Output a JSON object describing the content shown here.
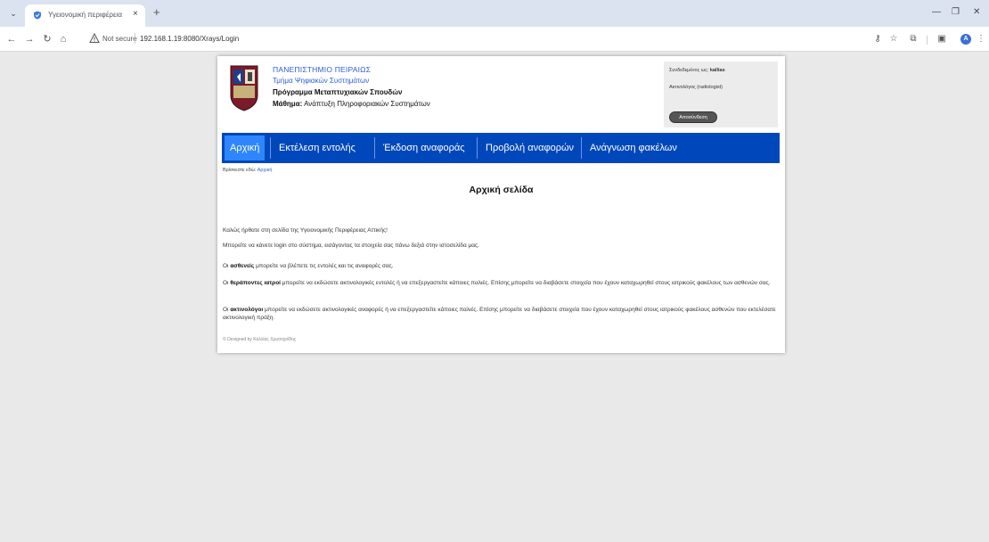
{
  "browser": {
    "tab_title": "Υγειονομική περιφέρεια",
    "not_secure": "Not secure",
    "url": "192.168.1.19:8080/Xrays/Login",
    "avatar_letter": "A"
  },
  "header": {
    "university": "ΠΑΝΕΠΙΣΤΗΜΙΟ ΠΕΙΡΑΙΩΣ",
    "department": "Τμήμα Ψηφιακών Συστημάτων",
    "program": "Πρόγραμμα Μεταπτυχιακών Σπουδών",
    "course_label": "Μάθημα:",
    "course_name": "Ανάπτυξη Πληροφοριακών Συστημάτων"
  },
  "user": {
    "logged_in_label": "Συνδεδεμένος ως:",
    "username": "kallias",
    "role": "Ακτινολόγος (radiologist)",
    "logout_label": "Αποσύνδεση"
  },
  "menu": [
    {
      "label": "Αρχική"
    },
    {
      "label": "Εκτέλεση εντολής"
    },
    {
      "label": "Έκδοση αναφοράς"
    },
    {
      "label": "Προβολή αναφορών"
    },
    {
      "label": "Ανάγνωση φακέλων"
    }
  ],
  "breadcrumb": {
    "prefix": "Βρίσκεστε εδώ:",
    "current": "Αρχική"
  },
  "page_title": "Αρχική σελίδα",
  "content": {
    "welcome": "Καλώς ήρθατε στη σελίδα της Υγειονομικής Περιφέρειας Αττικής!",
    "login_info": "Μπορείτε να κάνετε login στο σύστημα, εισάγοντας τα στοιχεία σας πάνω δεξιά στην ιστοσελίδα μας.",
    "patients_strong": "ασθενείς",
    "patients_pre": "Οι",
    "patients_rest": "μπορείτε να βλέπετε τις εντολές και τις αναφορές σας.",
    "doctors_pre": "Οι",
    "doctors_strong": "θεράποντες ιατροί",
    "doctors_rest": "μπορείτε να εκδώσετε ακτινολογικές εντολές ή να επεξεργαστείτε κάποιες παλιές. Επίσης μπορείτε να διαβάσετε στοιχεία που έχουν καταχωρηθεί στους ιατρικούς φακέλους των ασθενών σας.",
    "radiologists_pre": "Οι",
    "radiologists_strong": "ακτινολόγοι",
    "radiologists_rest": "μπορείτε να εκδώσετε ακτινολογικές αναφορές ή να επεξεργαστείτε κάποιες παλιές. Επίσης μπορείτε να διαβάσετε στοιχεία που έχουν καταχωρηθεί στους ιατρικούς φακέλους ασθενών που εκτελέσατε ακτινολογική πράξη."
  },
  "footer": "© Designed by Καλλίας Χρυσοχοΐδης"
}
